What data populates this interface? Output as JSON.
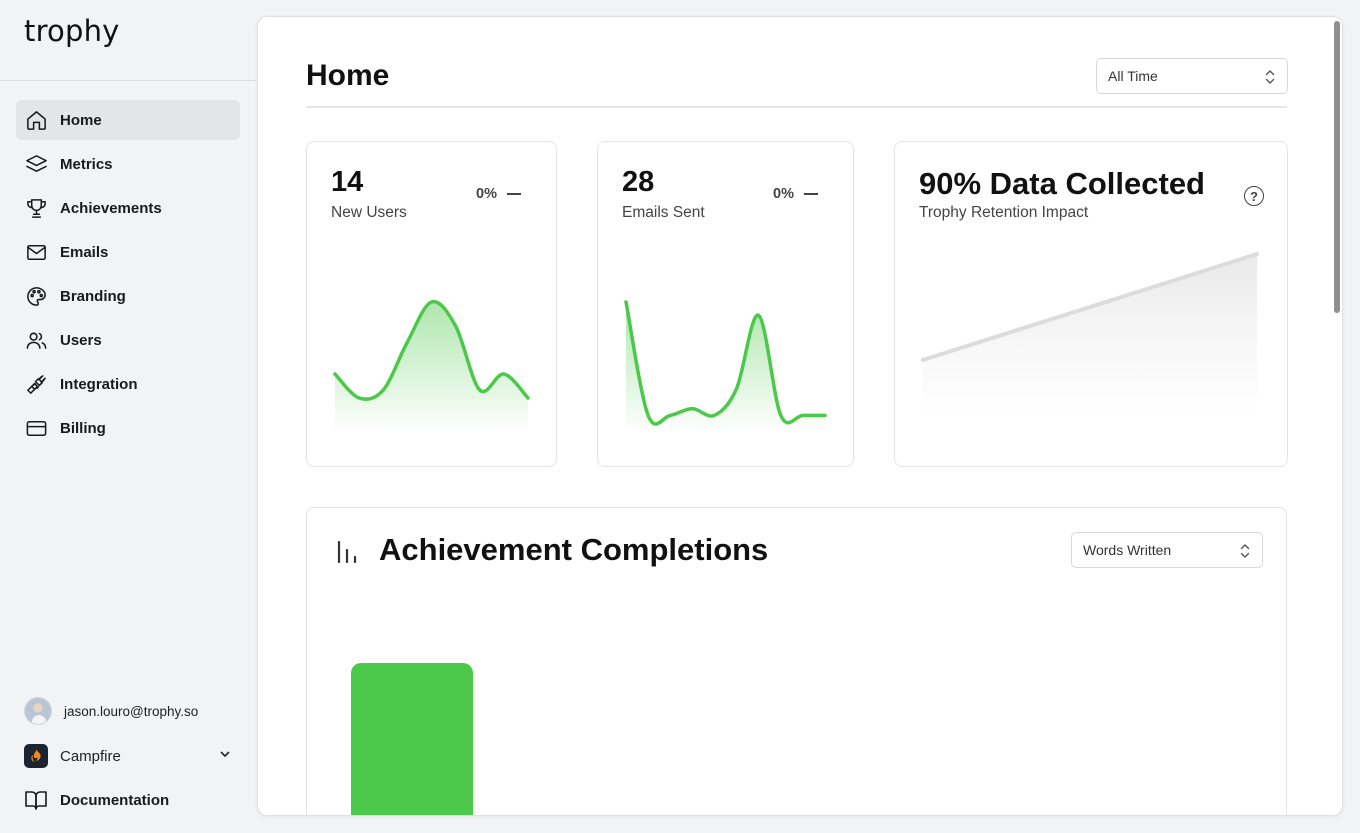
{
  "app": {
    "logo": "trophy"
  },
  "sidebar": {
    "items": [
      {
        "label": "Home",
        "icon": "home-icon",
        "active": true
      },
      {
        "label": "Metrics",
        "icon": "layers-icon",
        "active": false
      },
      {
        "label": "Achievements",
        "icon": "trophy-icon",
        "active": false
      },
      {
        "label": "Emails",
        "icon": "mail-icon",
        "active": false
      },
      {
        "label": "Branding",
        "icon": "palette-icon",
        "active": false
      },
      {
        "label": "Users",
        "icon": "users-icon",
        "active": false
      },
      {
        "label": "Integration",
        "icon": "plug-icon",
        "active": false
      },
      {
        "label": "Billing",
        "icon": "credit-card-icon",
        "active": false
      }
    ],
    "user_email": "jason.louro@trophy.so",
    "workspace": "Campfire",
    "documentation": "Documentation"
  },
  "main": {
    "title": "Home",
    "range_select": "All Time",
    "cards": [
      {
        "value": "14",
        "label": "New Users",
        "change": "0%",
        "sparkline": [
          6,
          3,
          4,
          10,
          15,
          12,
          4,
          6,
          3
        ]
      },
      {
        "value": "28",
        "label": "Emails Sent",
        "change": "0%",
        "sparkline": [
          18,
          1,
          1,
          2,
          1,
          5,
          16,
          1,
          1,
          1
        ]
      }
    ],
    "retention": {
      "title": "90% Data Collected",
      "subtitle": "Trophy Retention Impact"
    },
    "achievements": {
      "title": "Achievement Completions",
      "metric_select": "Words Written"
    }
  },
  "colors": {
    "accent": "#4cc84a",
    "sidebar_bg": "#f2f3f5",
    "active_bg": "#e4e5e8"
  }
}
